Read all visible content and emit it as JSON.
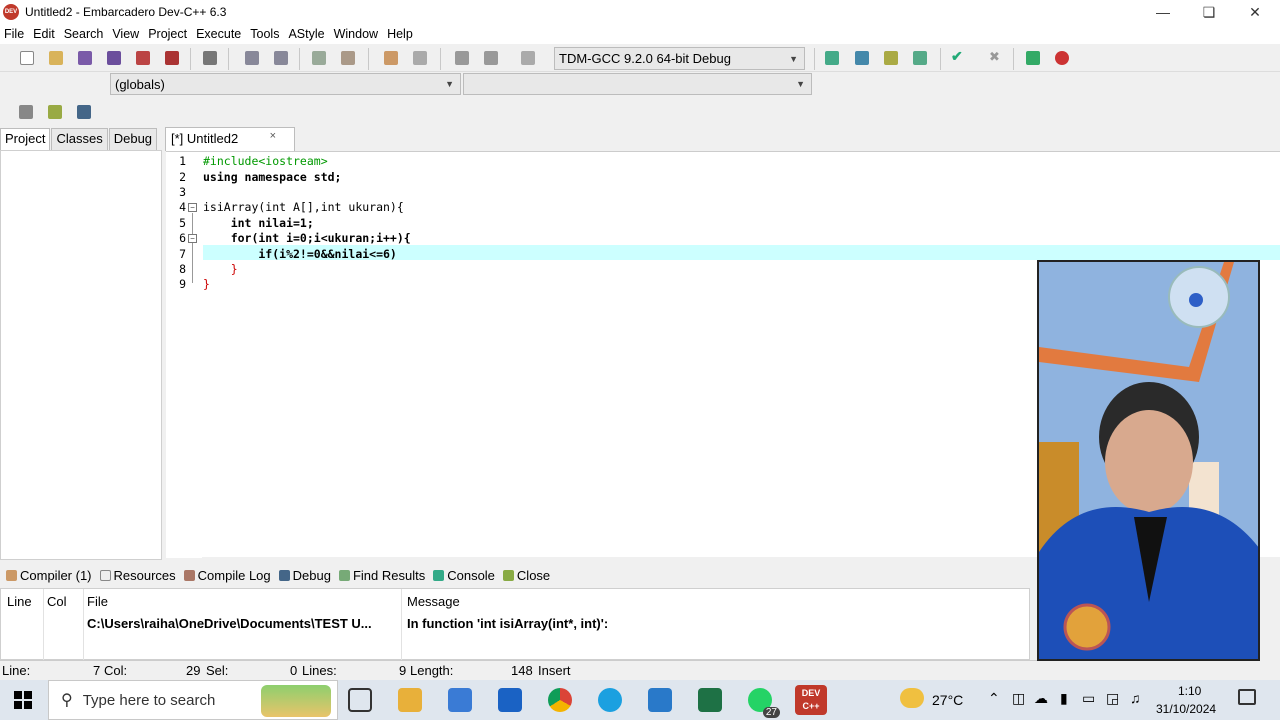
{
  "window": {
    "title": "Untitled2 - Embarcadero Dev-C++ 6.3",
    "app_icon_text": "DEV"
  },
  "menu": [
    "File",
    "Edit",
    "Search",
    "View",
    "Project",
    "Execute",
    "Tools",
    "AStyle",
    "Window",
    "Help"
  ],
  "toolbar": {
    "compiler_select": "TDM-GCC 9.2.0 64-bit Debug",
    "scope_select": "(globals)",
    "member_select": ""
  },
  "left_tabs": [
    "Project",
    "Classes",
    "Debug"
  ],
  "editor_tab": {
    "label": "[*] Untitled2",
    "close": "×"
  },
  "editor": {
    "lines": [
      {
        "n": "1",
        "text": "#include<iostream>"
      },
      {
        "n": "2",
        "text": "using namespace std;"
      },
      {
        "n": "3",
        "text": ""
      },
      {
        "n": "4",
        "text": "isiArray(int A[],int ukuran){"
      },
      {
        "n": "5",
        "text": "    int nilai=1;"
      },
      {
        "n": "6",
        "text": "    for(int i=0;i<ukuran;i++){"
      },
      {
        "n": "7",
        "text": "        if(i%2!=0&&nilai<=6)"
      },
      {
        "n": "8",
        "text": "    }"
      },
      {
        "n": "9",
        "text": "}"
      }
    ]
  },
  "bottom_tabs": [
    "Compiler (1)",
    "Resources",
    "Compile Log",
    "Debug",
    "Find Results",
    "Console",
    "Close"
  ],
  "compiler_table": {
    "headers": [
      "Line",
      "Col",
      "File",
      "Message"
    ],
    "rows": [
      {
        "line": "",
        "col": "",
        "file": "C:\\Users\\raiha\\OneDrive\\Documents\\TEST U...",
        "message": "In function 'int isiArray(int*, int)':"
      }
    ]
  },
  "status": {
    "line_label": "Line:",
    "line_value": "7",
    "col_label": "Col:",
    "col_value": "29",
    "sel_label": "Sel:",
    "sel_value": "0",
    "lines_label": "Lines:",
    "lines_value": "9",
    "length_label": "Length:",
    "length_value": "148",
    "mode": "Insert"
  },
  "taskbar": {
    "search_placeholder": "Type here to search",
    "weather": "27°C",
    "time": "1:10",
    "date": "31/10/2024",
    "whatsapp_badge": "27",
    "devcpp_label": "DEV C++"
  },
  "colors": {
    "current_line": "#ccffff",
    "keyword": "#000000",
    "preprocessor": "#009900",
    "number": "#ff3300"
  }
}
